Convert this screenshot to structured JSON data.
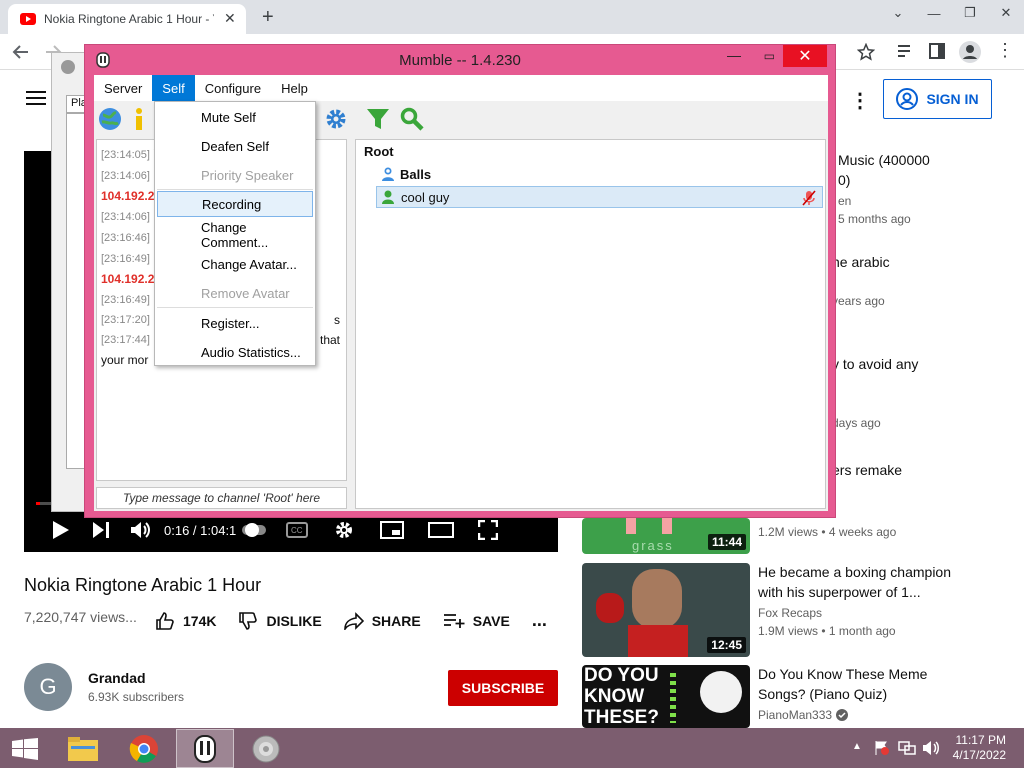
{
  "browser": {
    "tab_title": "Nokia Ringtone Arabic 1 Hour - Y",
    "new_tab": "+",
    "close_tab": "✕"
  },
  "youtube": {
    "sign_in": "SIGN IN",
    "video_title": "Nokia Ringtone Arabic 1 Hour",
    "views": "7,220,747 views...",
    "likes": "174K",
    "dislike": "DISLIKE",
    "share": "SHARE",
    "save": "SAVE",
    "more": "...",
    "time": "0:16 / 1:04:1",
    "progress_fraction": 0.004,
    "channel_initial": "G",
    "channel_name": "Grandad",
    "subscribers": "6.93K subscribers",
    "subscribe": "SUBSCRIBE",
    "recommendations": [
      {
        "title": "Music (400000",
        "title2": "0)",
        "channel": "en",
        "meta": "5 months ago"
      },
      {
        "title": "ne arabic",
        "meta": "years ago"
      },
      {
        "title": "y to avoid any",
        "meta": "days ago"
      },
      {
        "title": "ers remake",
        "meta": "",
        "views": "1.2M views • 4 weeks ago",
        "duration": "11:44",
        "thumb_text": "grass"
      },
      {
        "title": "He became a boxing champion",
        "title2": "with his superpower of 1...",
        "channel": "Fox Recaps",
        "meta": "1.9M views • 1 month ago",
        "duration": "12:45"
      },
      {
        "title": "Do You Know These Meme",
        "title2": "Songs? (Piano Quiz)",
        "channel": "PianoMan333",
        "thumb_text": [
          "DO YOU",
          "KNOW",
          "THESE?"
        ]
      }
    ]
  },
  "mumble": {
    "title": "Mumble -- 1.4.230",
    "menus": [
      "Server",
      "Self",
      "Configure",
      "Help"
    ],
    "active_menu": "Self",
    "self_menu": [
      {
        "label": "Mute Self",
        "enabled": true
      },
      {
        "label": "Deafen Self",
        "enabled": true
      },
      {
        "label": "Priority Speaker",
        "enabled": false
      },
      {
        "label": "Recording",
        "enabled": true,
        "highlighted": true
      },
      {
        "label": "Change Comment...",
        "enabled": true
      },
      {
        "label": "Change Avatar...",
        "enabled": true
      },
      {
        "label": "Remove Avatar",
        "enabled": false
      },
      {
        "label": "Register...",
        "enabled": true
      },
      {
        "label": "Audio Statistics...",
        "enabled": true
      }
    ],
    "chat": [
      {
        "ts": "[23:14:05]",
        "text": "`"
      },
      {
        "ts": "[23:14:06]",
        "text": ""
      },
      {
        "ip": "104.192.2"
      },
      {
        "ts": "[23:14:06]",
        "text": ""
      },
      {
        "ts": "[23:16:46]",
        "text": ""
      },
      {
        "ts": "[23:16:49]",
        "text": ""
      },
      {
        "ip": "104.192.2"
      },
      {
        "ts": "[23:16:49]",
        "text": ""
      },
      {
        "ts": "[23:17:20]",
        "text": "s"
      },
      {
        "ts": "[23:17:44]",
        "text": "that"
      },
      {
        "text": "your mor"
      }
    ],
    "chat_placeholder": "Type message to channel 'Root' here",
    "tree": {
      "root": "Root",
      "channel": "Balls",
      "user": "cool guy"
    }
  },
  "taskbar": {
    "time": "11:17 PM",
    "date": "4/17/2022"
  }
}
